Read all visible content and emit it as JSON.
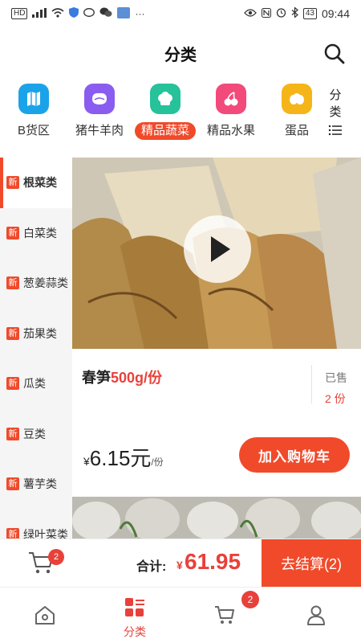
{
  "status_bar": {
    "left_badge": "HD",
    "left_signal": "⁴ᴳ",
    "battery": "43",
    "time": "09:44"
  },
  "header": {
    "title": "分类",
    "search_icon": "search-icon"
  },
  "categories": [
    {
      "label": "B货区",
      "icon": "map-icon",
      "color": "#1aa3e8"
    },
    {
      "label": "猪牛羊肉",
      "icon": "meat-icon",
      "color": "#8a5cf0"
    },
    {
      "label": "精品蔬菜",
      "icon": "vegetable-icon",
      "color": "#26c29a",
      "active": true
    },
    {
      "label": "精品水果",
      "icon": "cherry-icon",
      "color": "#f24a7a"
    },
    {
      "label": "蛋品",
      "icon": "egg-icon",
      "color": "#f5b518"
    }
  ],
  "category_more": {
    "line1": "分",
    "line2": "类",
    "icon": "list-icon"
  },
  "side_nav": {
    "new_tag": "新",
    "items": [
      "根菜类",
      "白菜类",
      "葱姜蒜类",
      "茄果类",
      "瓜类",
      "豆类",
      "薯芋类",
      "绿叶菜类"
    ]
  },
  "product": {
    "name": "春笋",
    "spec": "500g/份",
    "sold_label": "已售",
    "sold_count": "2 份",
    "price_symbol": "¥",
    "price": "6.15元",
    "price_unit": "/份",
    "add_to_cart": "加入购物车"
  },
  "cart_bar": {
    "cart_count": "2",
    "total_label": "合计:",
    "total_symbol": "¥",
    "total_amount": "61.95",
    "checkout": "去结算(2)"
  },
  "tab_bar": {
    "active_label": "分类",
    "cart_badge": "2"
  },
  "colors": {
    "accent": "#f04a2b",
    "price_red": "#e8413a"
  }
}
